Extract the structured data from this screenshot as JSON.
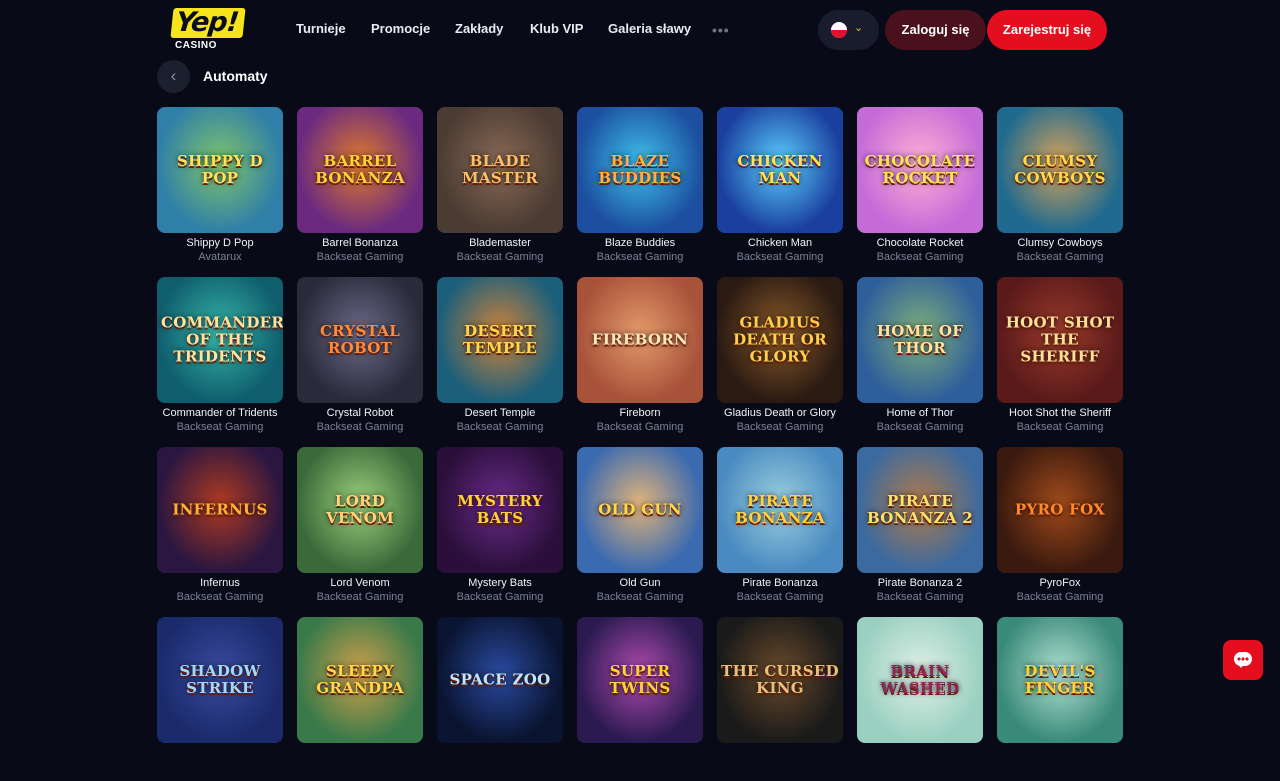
{
  "header": {
    "logo_text": "Yep!",
    "logo_sub": "CASINO",
    "nav": [
      "Turnieje",
      "Promocje",
      "Zakłady",
      "Klub VIP",
      "Galeria sławy"
    ],
    "more": "•••",
    "lang_icon": "flag-poland-icon",
    "chevron": "⌄",
    "login_label": "Zaloguj się",
    "register_label": "Zarejestruj się"
  },
  "colors": {
    "background": "#080b17",
    "accent_red": "#e40e1f",
    "logo_yellow": "#f5e51a",
    "provider_gray": "#7b8196"
  },
  "section": {
    "back_icon": "chevron-left-icon",
    "title": "Automaty"
  },
  "games": [
    {
      "name": "Shippy D Pop",
      "provider": "Avatarux",
      "art": "SHIPPY D POP"
    },
    {
      "name": "Barrel Bonanza",
      "provider": "Backseat Gaming",
      "art": "BARREL BONANZA"
    },
    {
      "name": "Blademaster",
      "provider": "Backseat Gaming",
      "art": "BLADE MASTER"
    },
    {
      "name": "Blaze Buddies",
      "provider": "Backseat Gaming",
      "art": "BLAZE BUDDIES"
    },
    {
      "name": "Chicken Man",
      "provider": "Backseat Gaming",
      "art": "CHICKEN MAN"
    },
    {
      "name": "Chocolate Rocket",
      "provider": "Backseat Gaming",
      "art": "CHOCOLATE ROCKET"
    },
    {
      "name": "Clumsy Cowboys",
      "provider": "Backseat Gaming",
      "art": "CLUMSY COWBOYS"
    },
    {
      "name": "Commander of Tridents",
      "provider": "Backseat Gaming",
      "art": "COMMANDER OF THE TRIDENTS"
    },
    {
      "name": "Crystal Robot",
      "provider": "Backseat Gaming",
      "art": "CRYSTAL ROBOT"
    },
    {
      "name": "Desert Temple",
      "provider": "Backseat Gaming",
      "art": "DESERT TEMPLE"
    },
    {
      "name": "Fireborn",
      "provider": "Backseat Gaming",
      "art": "FIREBORN"
    },
    {
      "name": "Gladius Death or Glory",
      "provider": "Backseat Gaming",
      "art": "GLADIUS DEATH OR GLORY"
    },
    {
      "name": "Home of Thor",
      "provider": "Backseat Gaming",
      "art": "HOME OF THOR"
    },
    {
      "name": "Hoot Shot the Sheriff",
      "provider": "Backseat Gaming",
      "art": "HOOT SHOT THE SHERIFF"
    },
    {
      "name": "Infernus",
      "provider": "Backseat Gaming",
      "art": "INFERNUS"
    },
    {
      "name": "Lord Venom",
      "provider": "Backseat Gaming",
      "art": "LORD VENOM"
    },
    {
      "name": "Mystery Bats",
      "provider": "Backseat Gaming",
      "art": "MYSTERY BATS"
    },
    {
      "name": "Old Gun",
      "provider": "Backseat Gaming",
      "art": "OLD GUN"
    },
    {
      "name": "Pirate Bonanza",
      "provider": "Backseat Gaming",
      "art": "PIRATE BONANZA"
    },
    {
      "name": "Pirate Bonanza 2",
      "provider": "Backseat Gaming",
      "art": "PIRATE BONANZA 2"
    },
    {
      "name": "PyroFox",
      "provider": "Backseat Gaming",
      "art": "PYRO FOX"
    },
    {
      "name": "",
      "provider": "",
      "art": "SHADOW STRIKE"
    },
    {
      "name": "",
      "provider": "",
      "art": "SLEEPY GRANDPA"
    },
    {
      "name": "",
      "provider": "",
      "art": "SPACE ZOO"
    },
    {
      "name": "",
      "provider": "",
      "art": "SUPER TWINS"
    },
    {
      "name": "",
      "provider": "",
      "art": "THE CURSED KING"
    },
    {
      "name": "",
      "provider": "",
      "art": "BRAIN WASHED"
    },
    {
      "name": "",
      "provider": "",
      "art": "DEVIL'S FINGER"
    }
  ],
  "chat": {
    "icon": "chat-bubble-icon"
  }
}
